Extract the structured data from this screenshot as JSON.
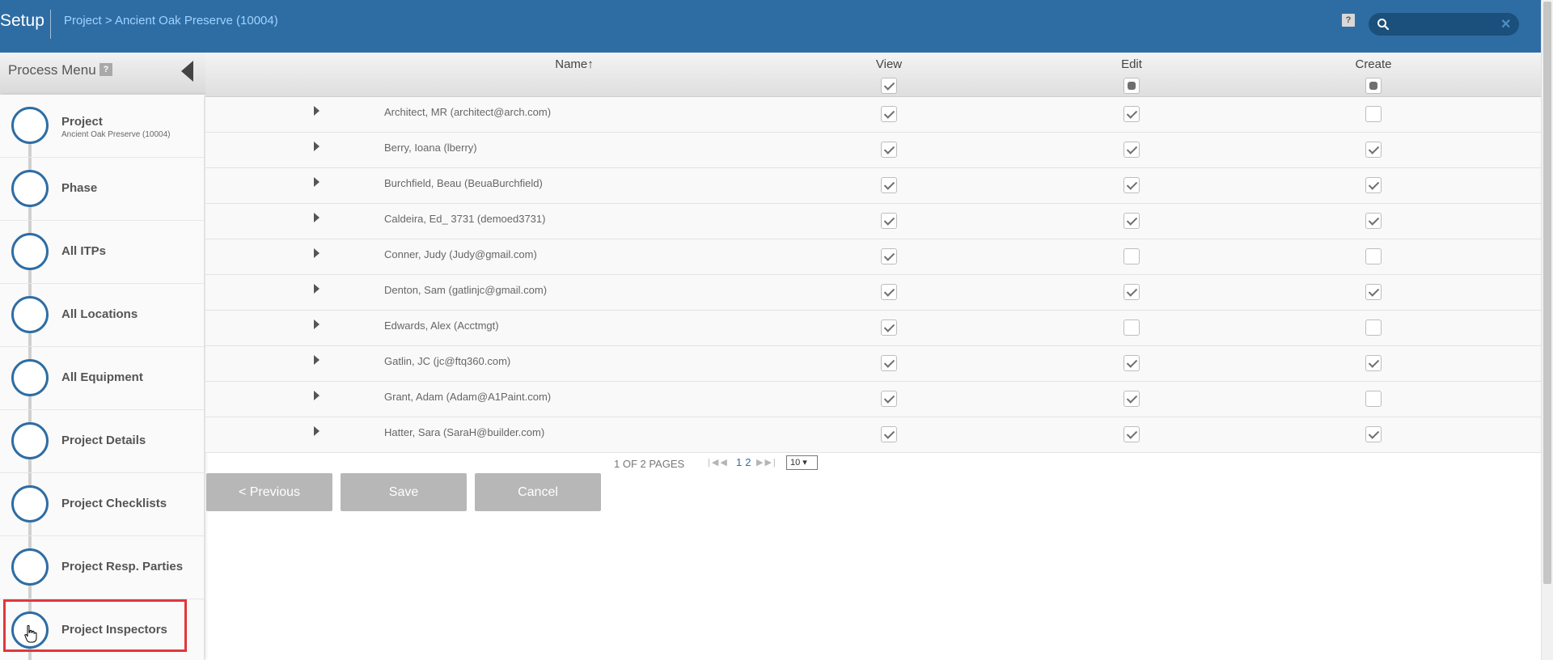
{
  "header": {
    "title": "Setup",
    "breadcrumb": "Project > Ancient Oak Preserve (10004)",
    "help_label": "?",
    "search_placeholder": "",
    "search_clear": "✕"
  },
  "process_menu": {
    "title": "Process Menu",
    "help_label": "?",
    "items": [
      {
        "label": "Project",
        "sub": "Ancient Oak Preserve (10004)"
      },
      {
        "label": "Phase",
        "sub": ""
      },
      {
        "label": "All ITPs",
        "sub": ""
      },
      {
        "label": "All Locations",
        "sub": ""
      },
      {
        "label": "All Equipment",
        "sub": ""
      },
      {
        "label": "Project Details",
        "sub": ""
      },
      {
        "label": "Project Checklists",
        "sub": ""
      },
      {
        "label": "Project Resp. Parties",
        "sub": ""
      },
      {
        "label": "Project Inspectors",
        "sub": ""
      }
    ],
    "highlighted_item": "Project Inspectors"
  },
  "table": {
    "columns": {
      "name": "Name↑",
      "view": "View",
      "edit": "Edit",
      "create": "Create"
    },
    "header_checks": {
      "view": "checked",
      "edit": "partial",
      "create": "partial"
    },
    "rows": [
      {
        "name": "Architect, MR (architect@arch.com)",
        "view": true,
        "edit": true,
        "create": false
      },
      {
        "name": "Berry, Ioana (lberry)",
        "view": true,
        "edit": true,
        "create": true
      },
      {
        "name": "Burchfield, Beau (BeuaBurchfield)",
        "view": true,
        "edit": true,
        "create": true
      },
      {
        "name": "Caldeira, Ed_ 3731 (demoed3731)",
        "view": true,
        "edit": true,
        "create": true
      },
      {
        "name": "Conner, Judy (Judy@gmail.com)",
        "view": true,
        "edit": false,
        "create": false
      },
      {
        "name": "Denton, Sam (gatlinjc@gmail.com)",
        "view": true,
        "edit": true,
        "create": true
      },
      {
        "name": "Edwards, Alex (Acctmgt)",
        "view": true,
        "edit": false,
        "create": false
      },
      {
        "name": "Gatlin, JC (jc@ftq360.com)",
        "view": true,
        "edit": true,
        "create": true
      },
      {
        "name": "Grant, Adam (Adam@A1Paint.com)",
        "view": true,
        "edit": true,
        "create": false
      },
      {
        "name": "Hatter, Sara (SaraH@builder.com)",
        "view": true,
        "edit": true,
        "create": true
      }
    ]
  },
  "pager": {
    "text": "1 OF 2 PAGES",
    "pages": [
      "1",
      "2"
    ],
    "current_page": "1",
    "page_size": "10 ▾"
  },
  "buttons": {
    "previous": "< Previous",
    "save": "Save",
    "cancel": "Cancel"
  }
}
